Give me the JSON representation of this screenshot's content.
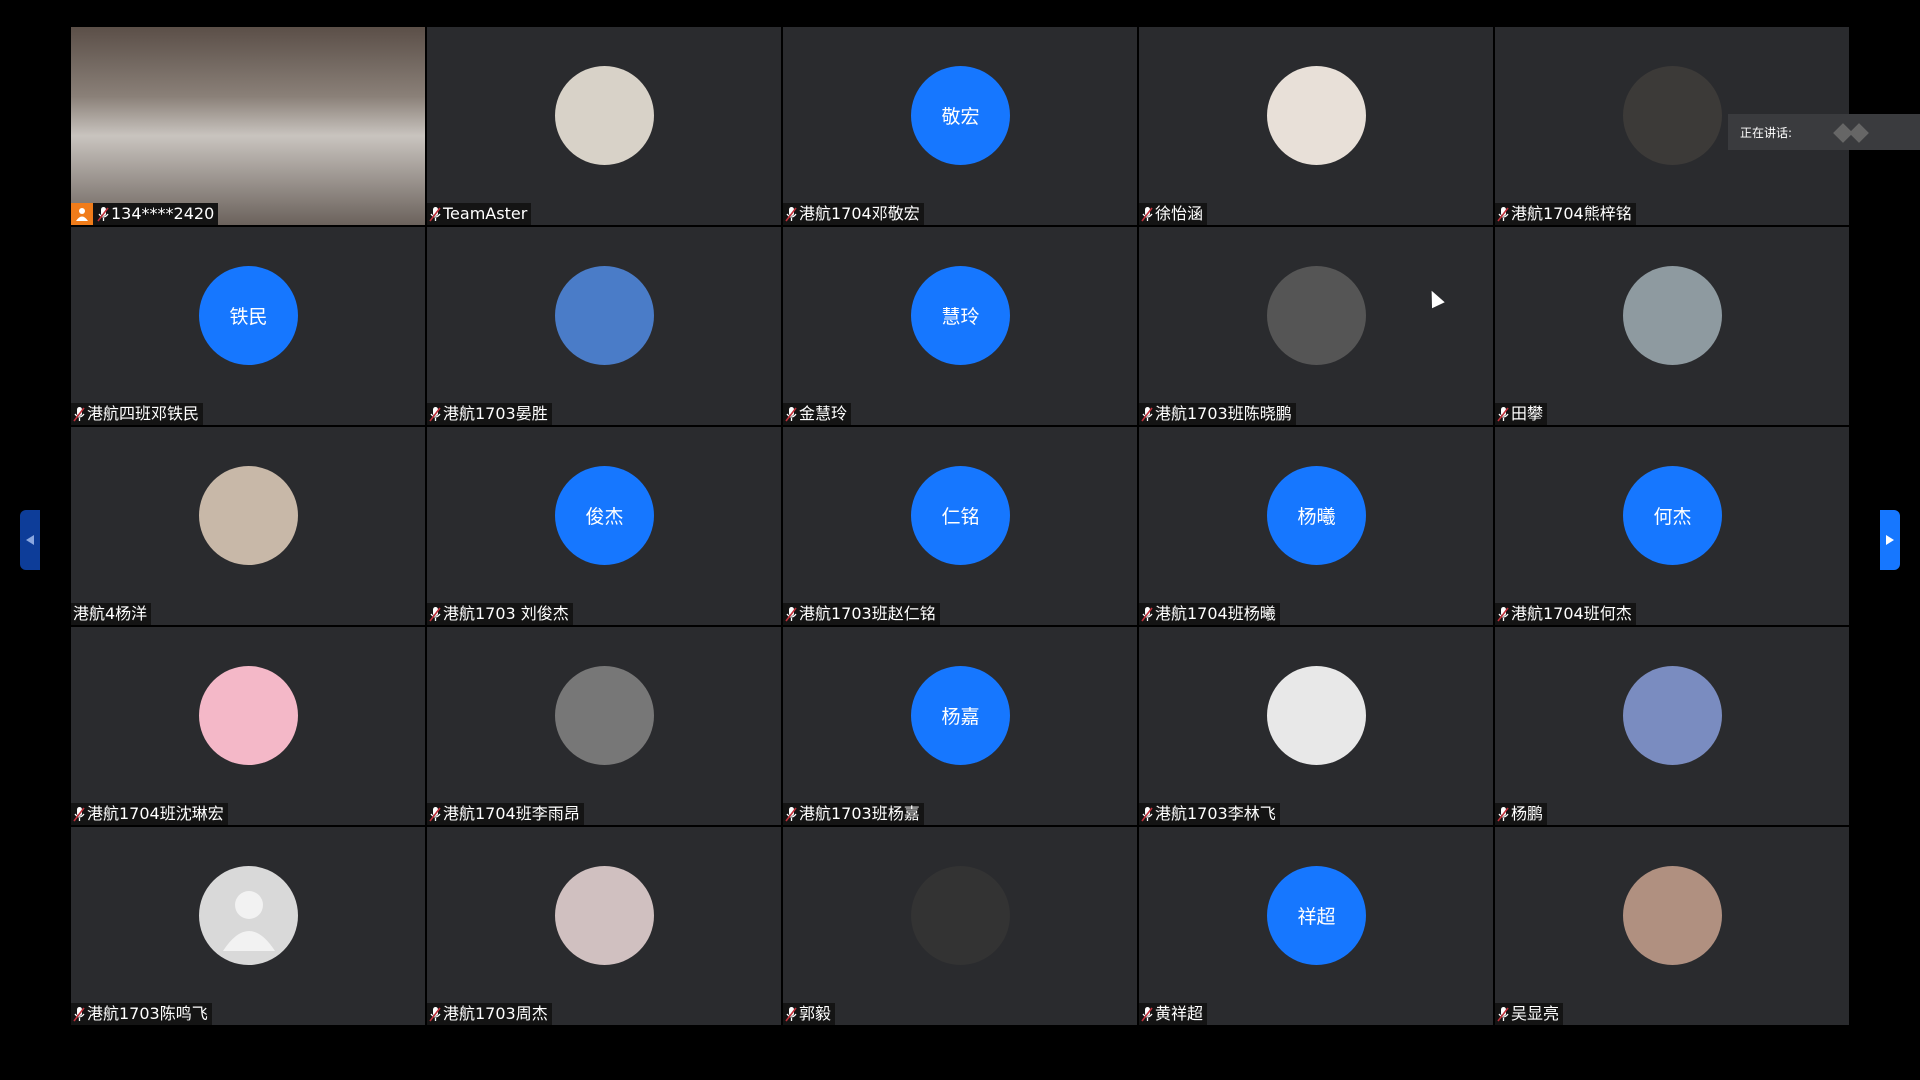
{
  "colors": {
    "avatar_blue": "#1677ff",
    "host_badge": "#f07c1a",
    "tile_bg": "#2a2b2e"
  },
  "speaking_panel": {
    "label": "正在讲话:"
  },
  "pager": {
    "prev_icon": "chevron-left-icon",
    "next_icon": "chevron-right-icon"
  },
  "participants": [
    {
      "name": "134****2420",
      "avatar": "video",
      "host": true,
      "muted": true
    },
    {
      "name": "TeamAster",
      "avatar": "image",
      "muted": true
    },
    {
      "name": "港航1704邓敬宏",
      "avatar_text": "敬宏",
      "muted": true
    },
    {
      "name": "徐怡涵",
      "avatar": "image",
      "muted": true
    },
    {
      "name": "港航1704熊梓铭",
      "avatar": "image",
      "muted": true
    },
    {
      "name": "港航四班邓铁民",
      "avatar_text": "铁民",
      "muted": true
    },
    {
      "name": "港航1703晏胜",
      "avatar": "image",
      "muted": true
    },
    {
      "name": "金慧玲",
      "avatar_text": "慧玲",
      "muted": true
    },
    {
      "name": "港航1703班陈晓鹏",
      "avatar": "image",
      "muted": true
    },
    {
      "name": "田攀",
      "avatar": "image",
      "muted": true
    },
    {
      "name": "港航4杨洋",
      "avatar": "image",
      "muted": false
    },
    {
      "name": "港航1703 刘俊杰",
      "avatar_text": "俊杰",
      "muted": true
    },
    {
      "name": "港航1703班赵仁铭",
      "avatar_text": "仁铭",
      "muted": true
    },
    {
      "name": "港航1704班杨曦",
      "avatar_text": "杨曦",
      "muted": true
    },
    {
      "name": "港航1704班何杰",
      "avatar_text": "何杰",
      "muted": true
    },
    {
      "name": "港航1704班沈琳宏",
      "avatar": "image",
      "muted": true
    },
    {
      "name": "港航1704班李雨昂",
      "avatar": "image",
      "muted": true
    },
    {
      "name": "港航1703班杨嘉",
      "avatar_text": "杨嘉",
      "muted": true
    },
    {
      "name": "港航1703李林飞",
      "avatar": "image",
      "muted": true
    },
    {
      "name": "杨鹏",
      "avatar": "image",
      "muted": true
    },
    {
      "name": "港航1703陈鸣飞",
      "avatar": "default",
      "muted": true
    },
    {
      "name": "港航1703周杰",
      "avatar": "image",
      "muted": true
    },
    {
      "name": "郭毅",
      "avatar": "image",
      "muted": true
    },
    {
      "name": "黄祥超",
      "avatar_text": "祥超",
      "muted": true
    },
    {
      "name": "吴显亮",
      "avatar": "image",
      "muted": true
    }
  ]
}
